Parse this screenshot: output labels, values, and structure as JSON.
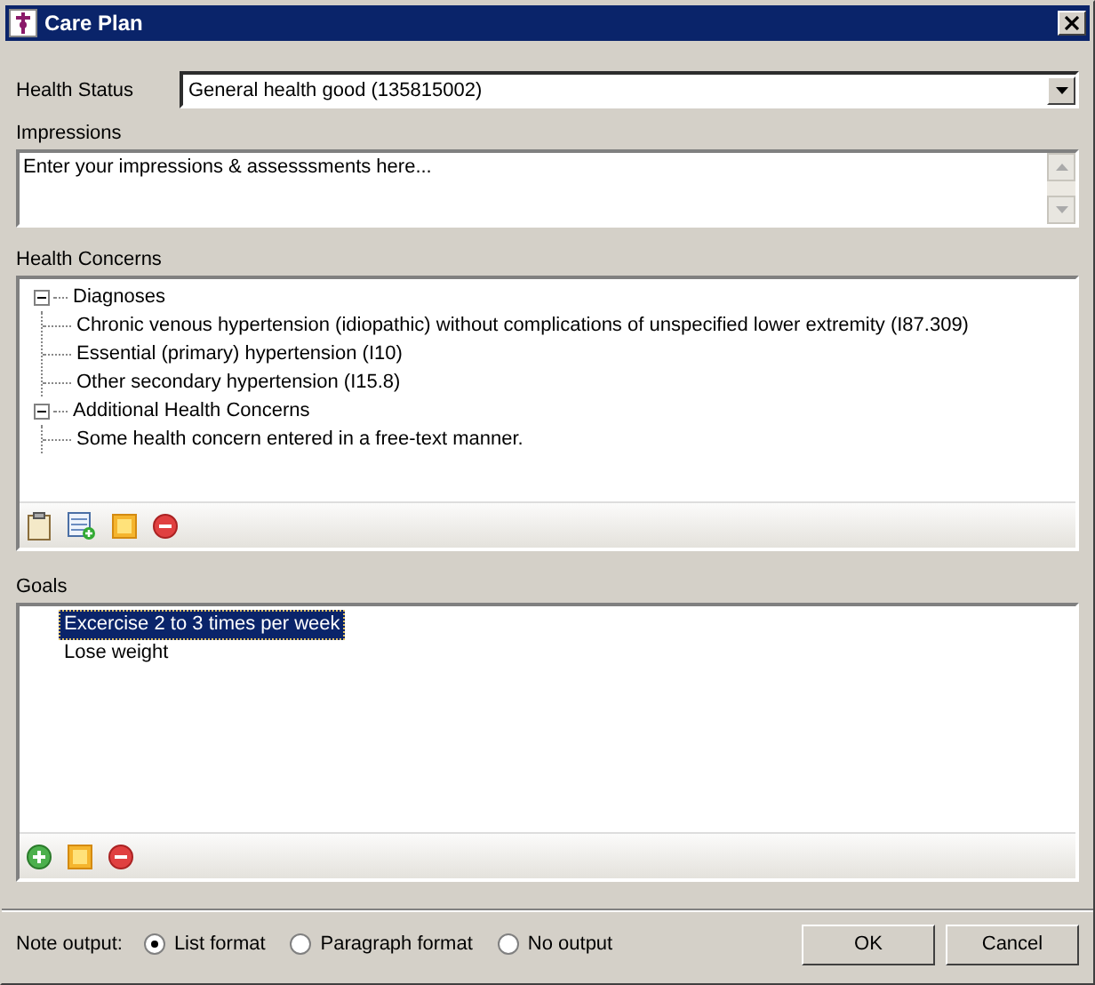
{
  "window": {
    "title": "Care Plan"
  },
  "health_status": {
    "label": "Health Status",
    "value": "General health good (135815002)"
  },
  "impressions": {
    "label": "Impressions",
    "placeholder": "Enter your impressions & assesssments here..."
  },
  "health_concerns": {
    "label": "Health Concerns",
    "tree": [
      {
        "label": "Diagnoses",
        "expanded": true,
        "children": [
          {
            "label": "Chronic venous hypertension (idiopathic) without complications of unspecified lower extremity (I87.309)"
          },
          {
            "label": "Essential (primary) hypertension (I10)"
          },
          {
            "label": "Other secondary hypertension (I15.8)"
          }
        ]
      },
      {
        "label": "Additional Health Concerns",
        "expanded": true,
        "children": [
          {
            "label": "Some health concern entered in a free-text manner."
          }
        ]
      }
    ],
    "toolbar": [
      {
        "kind": "clipboard"
      },
      {
        "kind": "add-table"
      },
      {
        "kind": "note"
      },
      {
        "kind": "remove"
      }
    ]
  },
  "goals": {
    "label": "Goals",
    "items": [
      {
        "label": "Excercise 2 to 3 times per week",
        "selected": true
      },
      {
        "label": "Lose weight",
        "selected": false
      }
    ],
    "toolbar": [
      {
        "kind": "add"
      },
      {
        "kind": "note"
      },
      {
        "kind": "remove"
      }
    ]
  },
  "note_output": {
    "label": "Note output:",
    "options": [
      {
        "label": "List format",
        "selected": true
      },
      {
        "label": "Paragraph format",
        "selected": false
      },
      {
        "label": "No output",
        "selected": false
      }
    ]
  },
  "buttons": [
    "OK",
    "Cancel"
  ]
}
